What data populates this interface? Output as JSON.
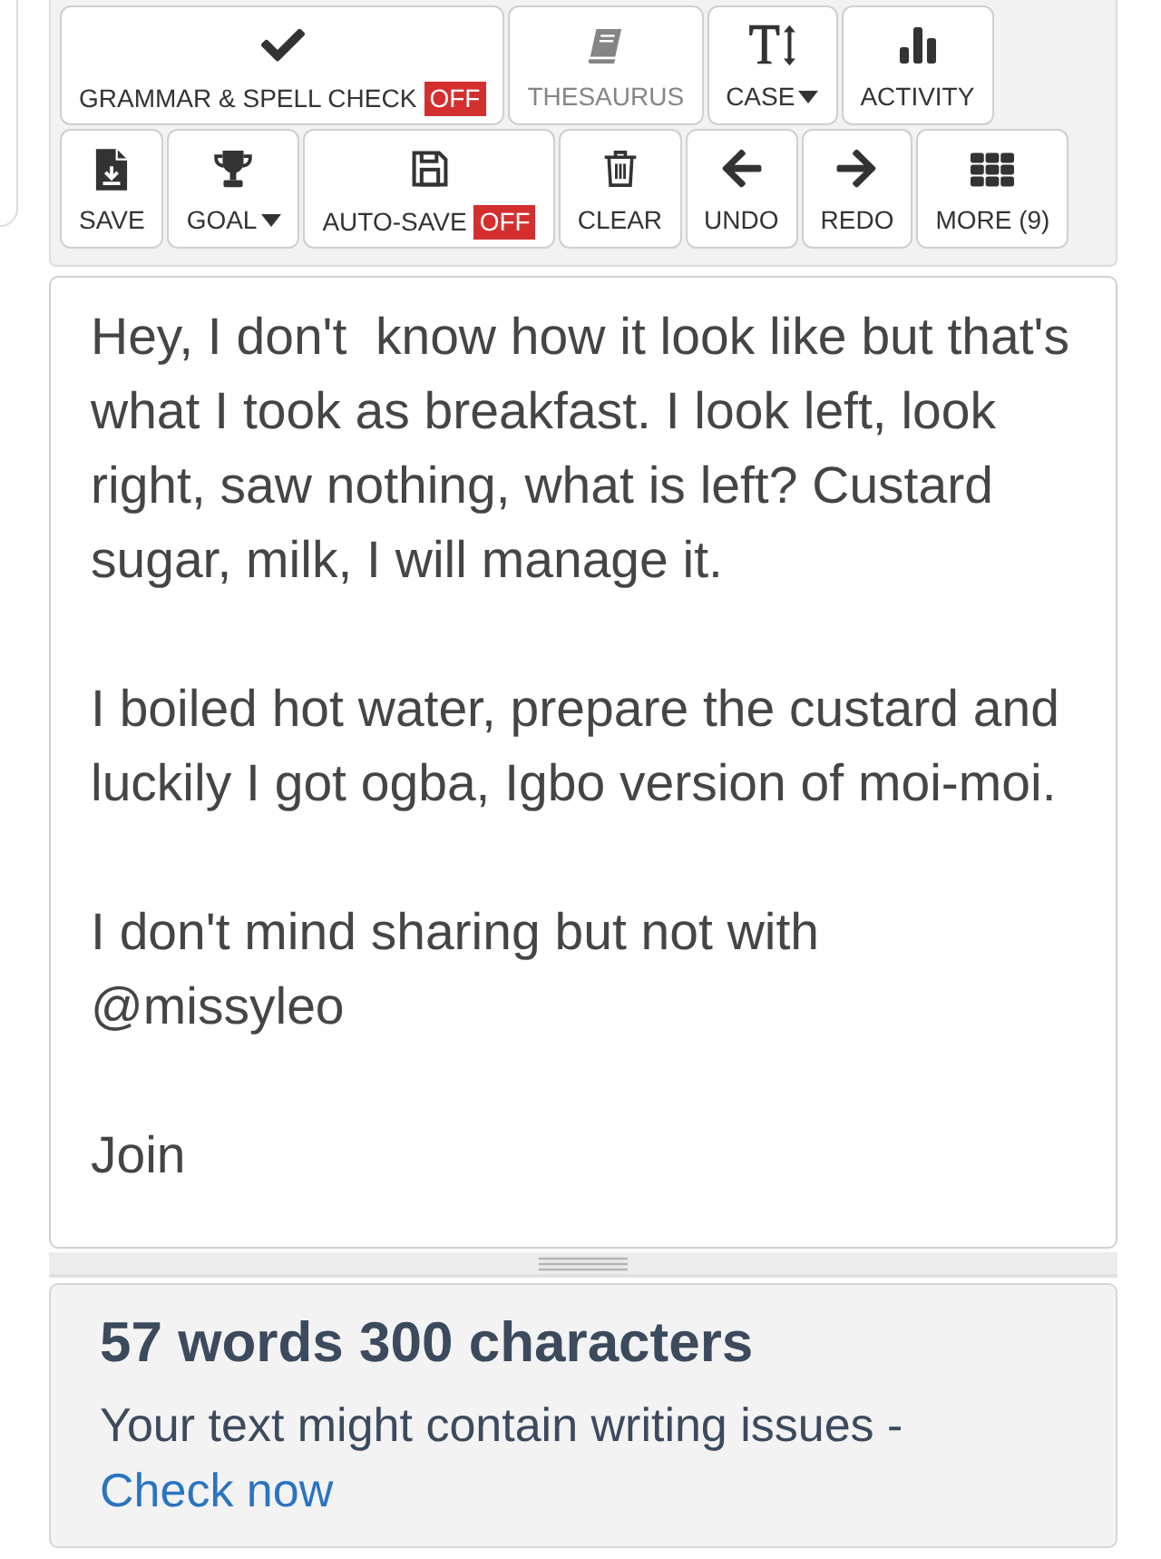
{
  "toolbar": {
    "buttons": [
      {
        "label": "GRAMMAR & SPELL CHECK",
        "badge": "OFF",
        "disabled": false,
        "dropdown": false
      },
      {
        "label": "THESAURUS",
        "disabled": true,
        "dropdown": false
      },
      {
        "label": "CASE",
        "disabled": false,
        "dropdown": true
      },
      {
        "label": "ACTIVITY",
        "disabled": false,
        "dropdown": false
      },
      {
        "label": "SAVE",
        "disabled": false,
        "dropdown": false
      },
      {
        "label": "GOAL",
        "disabled": false,
        "dropdown": true
      },
      {
        "label": "AUTO-SAVE",
        "badge": "OFF",
        "disabled": false,
        "dropdown": false
      },
      {
        "label": "CLEAR",
        "disabled": false,
        "dropdown": false
      },
      {
        "label": "UNDO",
        "disabled": false,
        "dropdown": false
      },
      {
        "label": "REDO",
        "disabled": false,
        "dropdown": false
      },
      {
        "label": "MORE (9)",
        "disabled": false,
        "dropdown": false
      }
    ]
  },
  "editor": {
    "value": "Hey, I don't  know how it look like but that's what I took as breakfast. I look left, look right, saw nothing, what is left? Custard sugar, milk, I will manage it.\n\nI boiled hot water, prepare the custard and luckily I got ogba, Igbo version of moi-moi.\n\nI don't mind sharing but not with @missyleo\n\nJoin"
  },
  "stats": {
    "summary": "57 words 300 characters",
    "message": "Your text might contain writing issues - ",
    "link": "Check now"
  }
}
